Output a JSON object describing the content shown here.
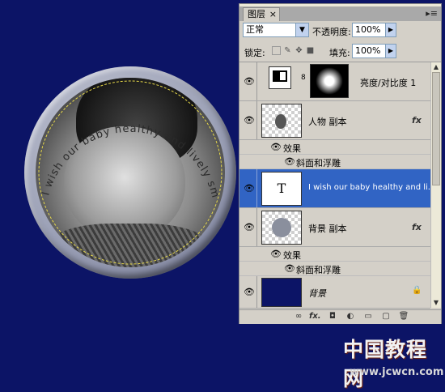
{
  "canvas": {
    "arc_text": "I wish our baby healthy and lively smart growth",
    "watermark": "中国教程网",
    "watermark_url": "www.jcwcn.com"
  },
  "panel": {
    "tab_label": "图层",
    "tab_close": "×",
    "menu_icon": "▸≡",
    "blend_mode": "正常",
    "opacity_label": "不透明度:",
    "opacity_value": "100%",
    "lock_label": "锁定:",
    "fill_label": "填充:",
    "fill_value": "100%",
    "layers": [
      {
        "name": "亮度/对比度 1",
        "type": "adjustment"
      },
      {
        "name": "人物 副本",
        "fx": "fx"
      },
      {
        "name": "效果"
      },
      {
        "name": "斜面和浮雕"
      },
      {
        "name": "I wish our baby healthy and li...",
        "thumb_text": "T",
        "selected": true
      },
      {
        "name": "背景 副本",
        "fx": "fx"
      },
      {
        "name": "效果"
      },
      {
        "name": "斜面和浮雕"
      },
      {
        "name": "背景",
        "locked": true
      }
    ],
    "bottom_icons": [
      "link-icon",
      "fx-icon",
      "mask-icon",
      "adjustment-icon",
      "group-icon",
      "new-layer-icon",
      "trash-icon"
    ],
    "bottom_fx": "fx."
  },
  "colors": {
    "background": "#0c1466",
    "selected": "#3164c4",
    "panel": "#d4d0c8"
  }
}
